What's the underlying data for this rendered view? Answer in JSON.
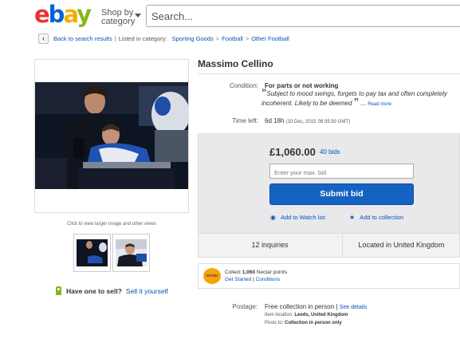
{
  "header": {
    "logo_text": "ebay",
    "shop_by_category": "Shop by category",
    "search_placeholder": "Search..."
  },
  "breadcrumb": {
    "back_label": "Back to search results",
    "listed_in": "Listed in category:",
    "items": [
      "Sporting Goods",
      "Football",
      "Other Football"
    ]
  },
  "gallery": {
    "click_hint": "Click to view larger image and other views",
    "thumbnails": [
      "thumbnail-1",
      "thumbnail-2"
    ]
  },
  "sell": {
    "question": "Have one to sell?",
    "link": "Sell it yourself"
  },
  "item": {
    "title": "Massimo Cellino",
    "condition_label": "Condition:",
    "condition_value": "For parts or not working",
    "condition_desc": "Subject to mood swings, forgets to pay tax and often completely incoherent. Likely to be deemed",
    "read_more": "Read more",
    "time_left_label": "Time left:",
    "time_left_value": "6d 18h",
    "time_left_date": "(10 Dec, 2015",
    "time_left_clock": "08:35:50 GMT)"
  },
  "bid": {
    "price": "£1,060.00",
    "bids": "40 bids",
    "input_placeholder": "Enter your max. bid",
    "submit_label": "Submit bid",
    "watch_label": "Add to Watch list",
    "collection_label": "Add to collection",
    "accent_color": "#1462c1"
  },
  "info": {
    "inquiries": "12 inquiries",
    "located": "Located in United Kingdom"
  },
  "nectar": {
    "logo": "nectar",
    "collect_prefix": "Collect",
    "points": "1,060",
    "collect_suffix": "Nectar points",
    "get_started": "Get Started",
    "conditions": "Conditions"
  },
  "postage": {
    "label": "Postage:",
    "value": "Free collection in person",
    "see_details": "See details",
    "item_location_label": "Item location:",
    "item_location": "Leeds, United Kingdom",
    "posts_to_label": "Posts to:",
    "posts_to": "Collection in person only"
  }
}
